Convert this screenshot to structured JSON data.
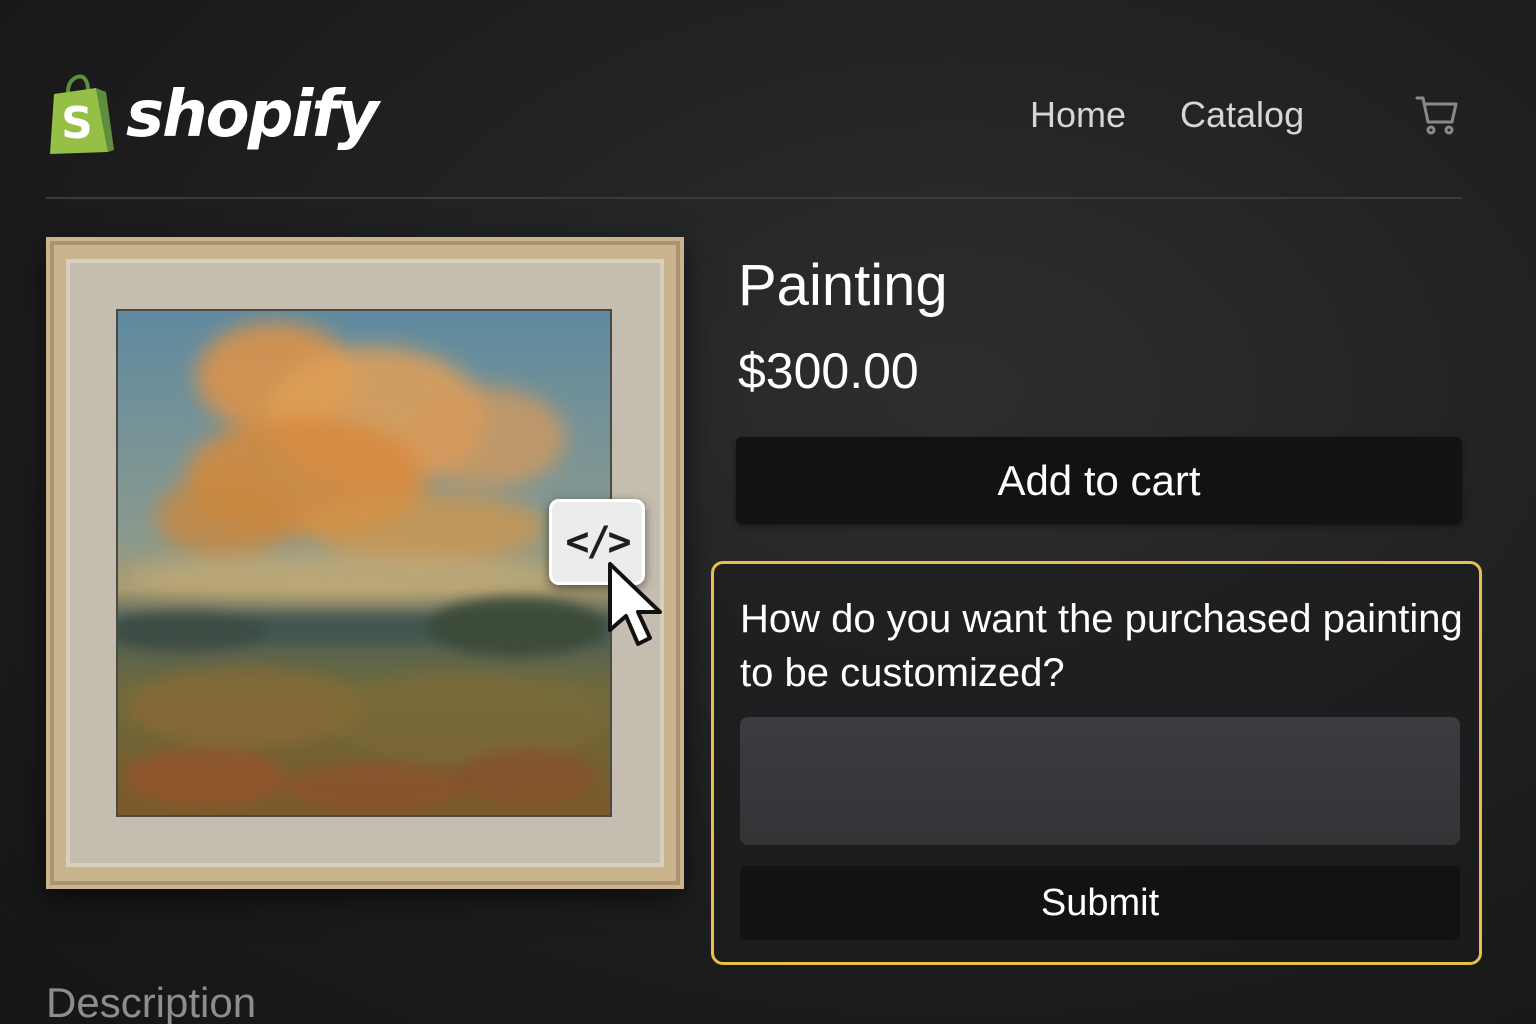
{
  "brand": {
    "name": "shopify",
    "logo_icon": "shopify-bag-icon"
  },
  "nav": {
    "links": [
      {
        "label": "Home"
      },
      {
        "label": "Catalog"
      }
    ],
    "cart_icon": "cart-icon"
  },
  "product": {
    "title": "Painting",
    "price": "$300.00",
    "add_to_cart_label": "Add to cart",
    "image_subject": "framed landscape painting"
  },
  "overlay": {
    "code_button_label": "</>",
    "cursor_icon": "mouse-pointer-icon"
  },
  "custom_form": {
    "question": "How do you want the purchased painting to be customized?",
    "input_value": "",
    "input_placeholder": "",
    "submit_label": "Submit"
  },
  "description": {
    "heading": "Description"
  },
  "colors": {
    "background": "#1c1c1d",
    "button_bg": "#121213",
    "form_border": "#e8bf47",
    "brand_green": "#95bf47"
  }
}
